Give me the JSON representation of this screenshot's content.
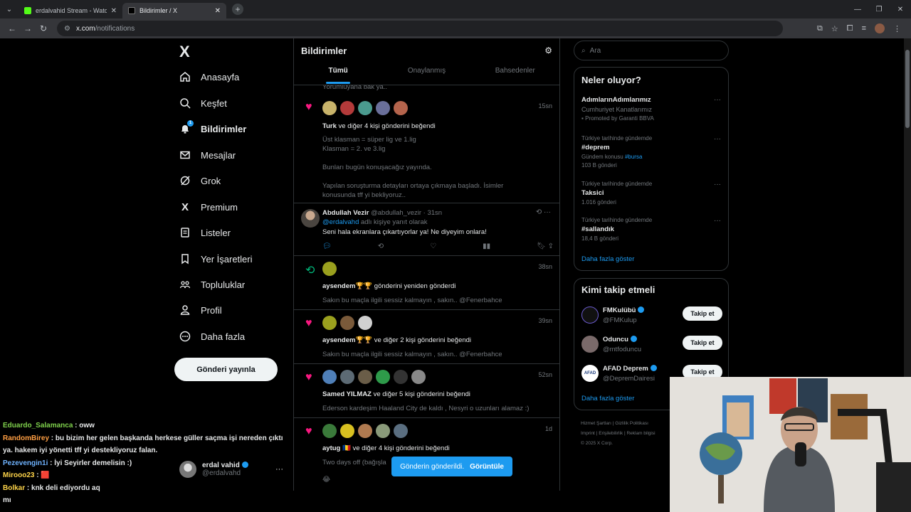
{
  "browser": {
    "tabs": [
      {
        "title": "erdalvahid Stream - Watch Live",
        "favicon_color": "#53fc18",
        "active": false
      },
      {
        "title": "Bildirimler / X",
        "favicon_color": "#000000",
        "active": true
      }
    ],
    "url_host": "x.com",
    "url_path": "/notifications"
  },
  "nav": {
    "logo": "X",
    "items": [
      {
        "label": "Anasayfa",
        "icon": "home-icon"
      },
      {
        "label": "Keşfet",
        "icon": "search-icon"
      },
      {
        "label": "Bildirimler",
        "icon": "bell-icon"
      },
      {
        "label": "Mesajlar",
        "icon": "mail-icon"
      },
      {
        "label": "Grok",
        "icon": "grok-icon"
      },
      {
        "label": "Premium",
        "icon": "x-premium-icon"
      },
      {
        "label": "Listeler",
        "icon": "list-icon"
      },
      {
        "label": "Yer İşaretleri",
        "icon": "bookmark-icon"
      },
      {
        "label": "Topluluklar",
        "icon": "communities-icon"
      },
      {
        "label": "Profil",
        "icon": "profile-icon"
      },
      {
        "label": "Daha fazla",
        "icon": "more-circle-icon"
      }
    ],
    "post_button": "Gönderi yayınla",
    "notification_badge": "1"
  },
  "account": {
    "name": "erdal vahid",
    "handle": "@erdalvahd"
  },
  "main": {
    "title": "Bildirimler",
    "tabs": [
      "Tümü",
      "Onaylanmış",
      "Bahsedenler"
    ],
    "clipped_top": "Yorumluyana bak ya..",
    "notifications": [
      {
        "type": "like",
        "time": "15sn",
        "actor": "Turk",
        "text": " ve diğer 4 kişi gönderini beğendi",
        "body": "Üst klasman = süper lig ve 1.lig\nKlasman = 2. ve 3.lig\n\nBunları bugün konuşacağız yayında.\n\nYapılan soruşturma detayları ortaya çıkmaya başladı. İsimler\nkonusunda tff yi bekliyoruz.."
      },
      {
        "type": "reply",
        "name": "Abdullah Vezir",
        "handle": "@abdullah_vezir",
        "time": "31sn",
        "reply_to_user": "@erdalvahd",
        "reply_to_suffix": " adlı kişiye yanıt olarak",
        "text": "Seni hala ekranlara çıkartıyorlar ya! Ne diyeyim onlara!"
      },
      {
        "type": "repost",
        "time": "38sn",
        "actor": "aysendem🏆🏆",
        "text": " gönderini yeniden gönderdi",
        "body": "Sakın bu maçla ilgili sessiz kalmayın , sakın.. @Fenerbahce"
      },
      {
        "type": "like",
        "time": "39sn",
        "actor": "aysendem🏆🏆",
        "text": " ve diğer 2 kişi gönderini beğendi",
        "body": "Sakın bu maçla ilgili sessiz kalmayın , sakın.. @Fenerbahce"
      },
      {
        "type": "like",
        "time": "52sn",
        "actor": "Samed YILMAZ",
        "text": " ve diğer 5 kişi gönderini beğendi",
        "body": "Ederson kardeşim Haaland City de kaldı , Nesyri o uzunları alamaz :)"
      },
      {
        "type": "like",
        "time": "1d",
        "actor": "aytug",
        "text": " 🇷🇴 ve diğer 4 kişi gönderini beğendi",
        "body": "Two days off (bağışla",
        "emoji": "😂"
      }
    ]
  },
  "toast": {
    "text": "Gönderin gönderildi.",
    "action": "Görüntüle"
  },
  "right": {
    "search_placeholder": "Ara",
    "trends_title": "Neler oluyor?",
    "trends": [
      {
        "meta": "",
        "name": "AdımlarınAdımlarımız",
        "sub": "Cumhuriyet Kanatlarımız",
        "count": "Promoted by Garanti BBVA"
      },
      {
        "meta": "Türkiye tarihinde gündemde",
        "name": "#deprem",
        "sub": "Gündem konusu ",
        "sub_link": "#bursa",
        "count": "103 B gönderi"
      },
      {
        "meta": "Türkiye tarihinde gündemde",
        "name": "Taksici",
        "sub": "",
        "count": "1.016 gönderi"
      },
      {
        "meta": "Türkiye tarihinde gündemde",
        "name": "#sallandık",
        "sub": "",
        "count": "18,4 B gönderi"
      }
    ],
    "trends_more": "Daha fazla göster",
    "who_title": "Kimi takip etmeli",
    "who": [
      {
        "name": "FMKulübü",
        "handle": "@FMKulup",
        "btn": "Takip et"
      },
      {
        "name": "Oduncu",
        "handle": "@mtfoduncu",
        "btn": "Takip et"
      },
      {
        "name": "AFAD Deprem",
        "handle": "@DepremDairesi",
        "btn": "Takip et"
      }
    ],
    "who_more": "Daha fazla göster",
    "footer": [
      "Hizmet Şartları",
      "Gizlilik Politikası",
      "Imprint",
      "Erişilebilirlik",
      "Reklam bilgisi",
      "© 2025 X Corp."
    ]
  },
  "chat": [
    {
      "user": "Eduardo_Salamanca",
      "color": "#7fd14c",
      "text": " : oww"
    },
    {
      "user": "RandomBirey",
      "color": "#ff9f43",
      "text": " : bu bizim her gelen başkanda herkese güller saçma işi nereden çıktı ya. hakem iyi yönetti tff yi destekliyoruz falan."
    },
    {
      "user": "Pezevengin1i",
      "color": "#6fb3ff",
      "text": " : İyi Seyirler demelisin :)"
    },
    {
      "user": "Mirooo23",
      "color": "#ffd54a",
      "text": " : 🟥"
    },
    {
      "user": "Bolkar",
      "color": "#ffd54a",
      "text": " : knk deli ediyordu aq"
    },
    {
      "user": "",
      "color": "#ffffff",
      "text": "mı"
    }
  ]
}
